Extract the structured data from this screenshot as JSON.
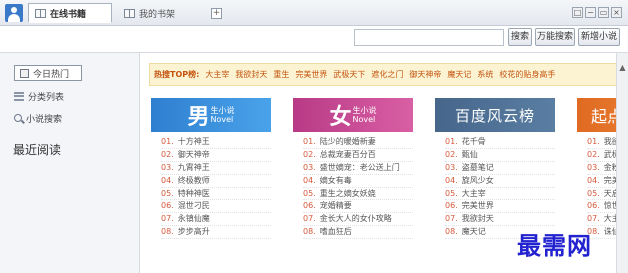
{
  "titlebar": {
    "tabs": [
      {
        "label": "在线书籍"
      },
      {
        "label": "我的书架"
      }
    ],
    "add_tab": "+",
    "window_buttons": [
      "□",
      "−",
      "▭",
      "×"
    ]
  },
  "search": {
    "placeholder": "",
    "buttons": [
      {
        "label": "搜索"
      },
      {
        "label": "万能搜索"
      },
      {
        "label": "新增小说"
      }
    ]
  },
  "sidebar": {
    "items": [
      {
        "label": "今日热门",
        "icon": "hot-icon"
      },
      {
        "label": "分类列表",
        "icon": "list-icon"
      },
      {
        "label": "小说搜索",
        "icon": "search-icon"
      }
    ],
    "recent_heading": "最近阅读"
  },
  "topbar": {
    "label": "热搜TOP榜:",
    "keywords": [
      "大主宰",
      "我欲封天",
      "重生",
      "完美世界",
      "武极天下",
      "遮化之门",
      "御天神帝",
      "魔天记",
      "系统",
      "校花的贴身高手"
    ]
  },
  "cards": [
    {
      "title_char": "男",
      "title_sub1": "生",
      "title_sub2": "小说",
      "title_sub3": "Novel",
      "color": "#3a8fdc",
      "items": [
        {
          "num": "01.",
          "name": "十方神王"
        },
        {
          "num": "02.",
          "name": "御天神帝"
        },
        {
          "num": "03.",
          "name": "九霄神王"
        },
        {
          "num": "04.",
          "name": "终极教师"
        },
        {
          "num": "05.",
          "name": "特种神医"
        },
        {
          "num": "06.",
          "name": "混世刁民"
        },
        {
          "num": "07.",
          "name": "永镇仙魔"
        },
        {
          "num": "08.",
          "name": "步步高升"
        }
      ]
    },
    {
      "title_char": "女",
      "title_sub1": "生",
      "title_sub2": "小说",
      "title_sub3": "Novel",
      "color": "#c8418b",
      "items": [
        {
          "num": "01.",
          "name": "陆少的暖婚新妻"
        },
        {
          "num": "02.",
          "name": "总裁宠妻百分百"
        },
        {
          "num": "03.",
          "name": "盛世嫡宠：老公送上门"
        },
        {
          "num": "04.",
          "name": "嫡女有毒"
        },
        {
          "num": "05.",
          "name": "重生之嫡女妖娆"
        },
        {
          "num": "06.",
          "name": "宠婚精要"
        },
        {
          "num": "07.",
          "name": "金长大人的女仆攻略"
        },
        {
          "num": "08.",
          "name": "嗜血狂后"
        }
      ]
    },
    {
      "title": "百度风云榜",
      "color": "#4f6f91",
      "items": [
        {
          "num": "01.",
          "name": "花千骨"
        },
        {
          "num": "02.",
          "name": "甄仙"
        },
        {
          "num": "03.",
          "name": "盗墓笔记"
        },
        {
          "num": "04.",
          "name": "旋风少女"
        },
        {
          "num": "05.",
          "name": "大主宰"
        },
        {
          "num": "06.",
          "name": "完美世界"
        },
        {
          "num": "07.",
          "name": "我欲封天"
        },
        {
          "num": "08.",
          "name": "魔天记"
        }
      ]
    },
    {
      "title": "起点",
      "color": "#e5792c",
      "items": [
        {
          "num": "01.",
          "name": "我欲"
        },
        {
          "num": "02.",
          "name": "武极"
        },
        {
          "num": "03.",
          "name": "金粉"
        },
        {
          "num": "04.",
          "name": "完美"
        },
        {
          "num": "05.",
          "name": "天启"
        },
        {
          "num": "06.",
          "name": "惊世"
        },
        {
          "num": "07.",
          "name": "大主"
        },
        {
          "num": "08.",
          "name": "诛仙"
        }
      ]
    }
  ],
  "watermark": "最需网"
}
